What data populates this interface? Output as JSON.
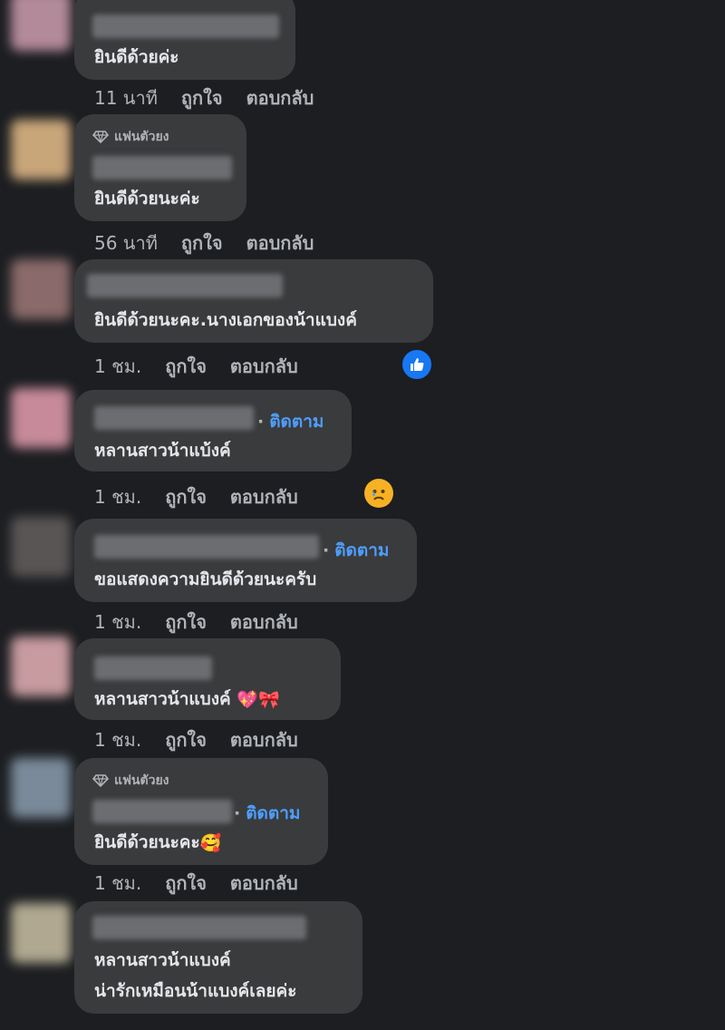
{
  "actions": {
    "like": "ถูกใจ",
    "reply": "ตอบกลับ"
  },
  "follow_label": "ติดตาม",
  "fan_badge": "แฟนตัวยง",
  "comments": [
    {
      "text": "ยินดีด้วยค่ะ",
      "time": "11 นาที",
      "avatar_color": "#b38a9a"
    },
    {
      "text": "ยินดีด้วยนะค่ะ",
      "time": "56 นาที",
      "avatar_color": "#c9a67a",
      "badge": "แฟนตัวยง"
    },
    {
      "text": "ยินดีด้วยนะคะ.นางเอกของน้าแบงค์",
      "time": "1 ชม.",
      "avatar_color": "#8a6a6a",
      "reaction": "like"
    },
    {
      "text": "หลานสาวน้าแบ้งค์",
      "time": "1 ชม.",
      "avatar_color": "#c68a9a",
      "follow": true,
      "reaction": "sad"
    },
    {
      "text": "ขอแสดงความยินดีด้วยนะครับ",
      "time": "1 ชม.",
      "avatar_color": "#5a5555",
      "follow": true
    },
    {
      "text": "หลานสาวน้าแบงค์",
      "time": "1 ชม.",
      "avatar_color": "#c79ba0",
      "emoji": "💖🎀"
    },
    {
      "text": "ยินดีด้วยนะคะ",
      "time": "1 ชม.",
      "avatar_color": "#7a8a9a",
      "badge": "แฟนตัวยง",
      "follow": true,
      "emoji": "🥰"
    },
    {
      "text_line1": "หลานสาวน้าแบงค์",
      "text_line2": "น่ารักเหมือนน้าแบงค์เลยค่ะ",
      "avatar_color": "#b0a890"
    }
  ]
}
